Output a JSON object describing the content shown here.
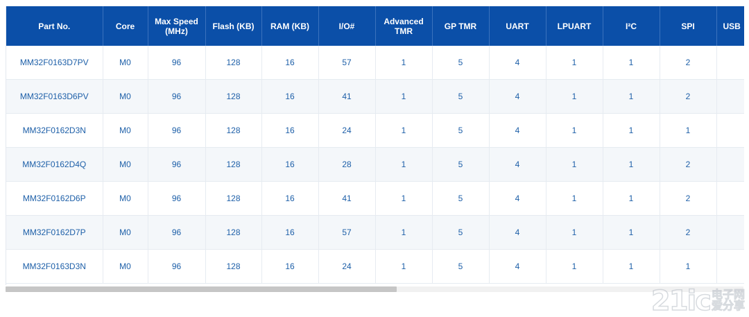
{
  "table": {
    "headers": [
      "Part No.",
      "Core",
      "Max Speed (MHz)",
      "Flash (KB)",
      "RAM (KB)",
      "I/O#",
      "Advanced TMR",
      "GP TMR",
      "UART",
      "LPUART",
      "I²C",
      "SPI",
      "USB"
    ],
    "rows": [
      [
        "MM32F0163D7PV",
        "M0",
        "96",
        "128",
        "16",
        "57",
        "1",
        "5",
        "4",
        "1",
        "1",
        "2",
        ""
      ],
      [
        "MM32F0163D6PV",
        "M0",
        "96",
        "128",
        "16",
        "41",
        "1",
        "5",
        "4",
        "1",
        "1",
        "2",
        ""
      ],
      [
        "MM32F0162D3N",
        "M0",
        "96",
        "128",
        "16",
        "24",
        "1",
        "5",
        "4",
        "1",
        "1",
        "1",
        ""
      ],
      [
        "MM32F0162D4Q",
        "M0",
        "96",
        "128",
        "16",
        "28",
        "1",
        "5",
        "4",
        "1",
        "1",
        "2",
        ""
      ],
      [
        "MM32F0162D6P",
        "M0",
        "96",
        "128",
        "16",
        "41",
        "1",
        "5",
        "4",
        "1",
        "1",
        "2",
        ""
      ],
      [
        "MM32F0162D7P",
        "M0",
        "96",
        "128",
        "16",
        "57",
        "1",
        "5",
        "4",
        "1",
        "1",
        "2",
        ""
      ],
      [
        "MM32F0163D3N",
        "M0",
        "96",
        "128",
        "16",
        "24",
        "1",
        "5",
        "4",
        "1",
        "1",
        "1",
        ""
      ]
    ]
  },
  "scrollbar": {
    "horizontal_position": 0.0,
    "visible_fraction": 0.53
  },
  "watermark": {
    "logo": "21ic",
    "line1": "电子网",
    "line2": "爱分享"
  },
  "colors": {
    "header_bg": "#0b4fa8",
    "header_text": "#ffffff",
    "cell_text": "#1d5fa8",
    "stripe": "#f4f7fa"
  }
}
